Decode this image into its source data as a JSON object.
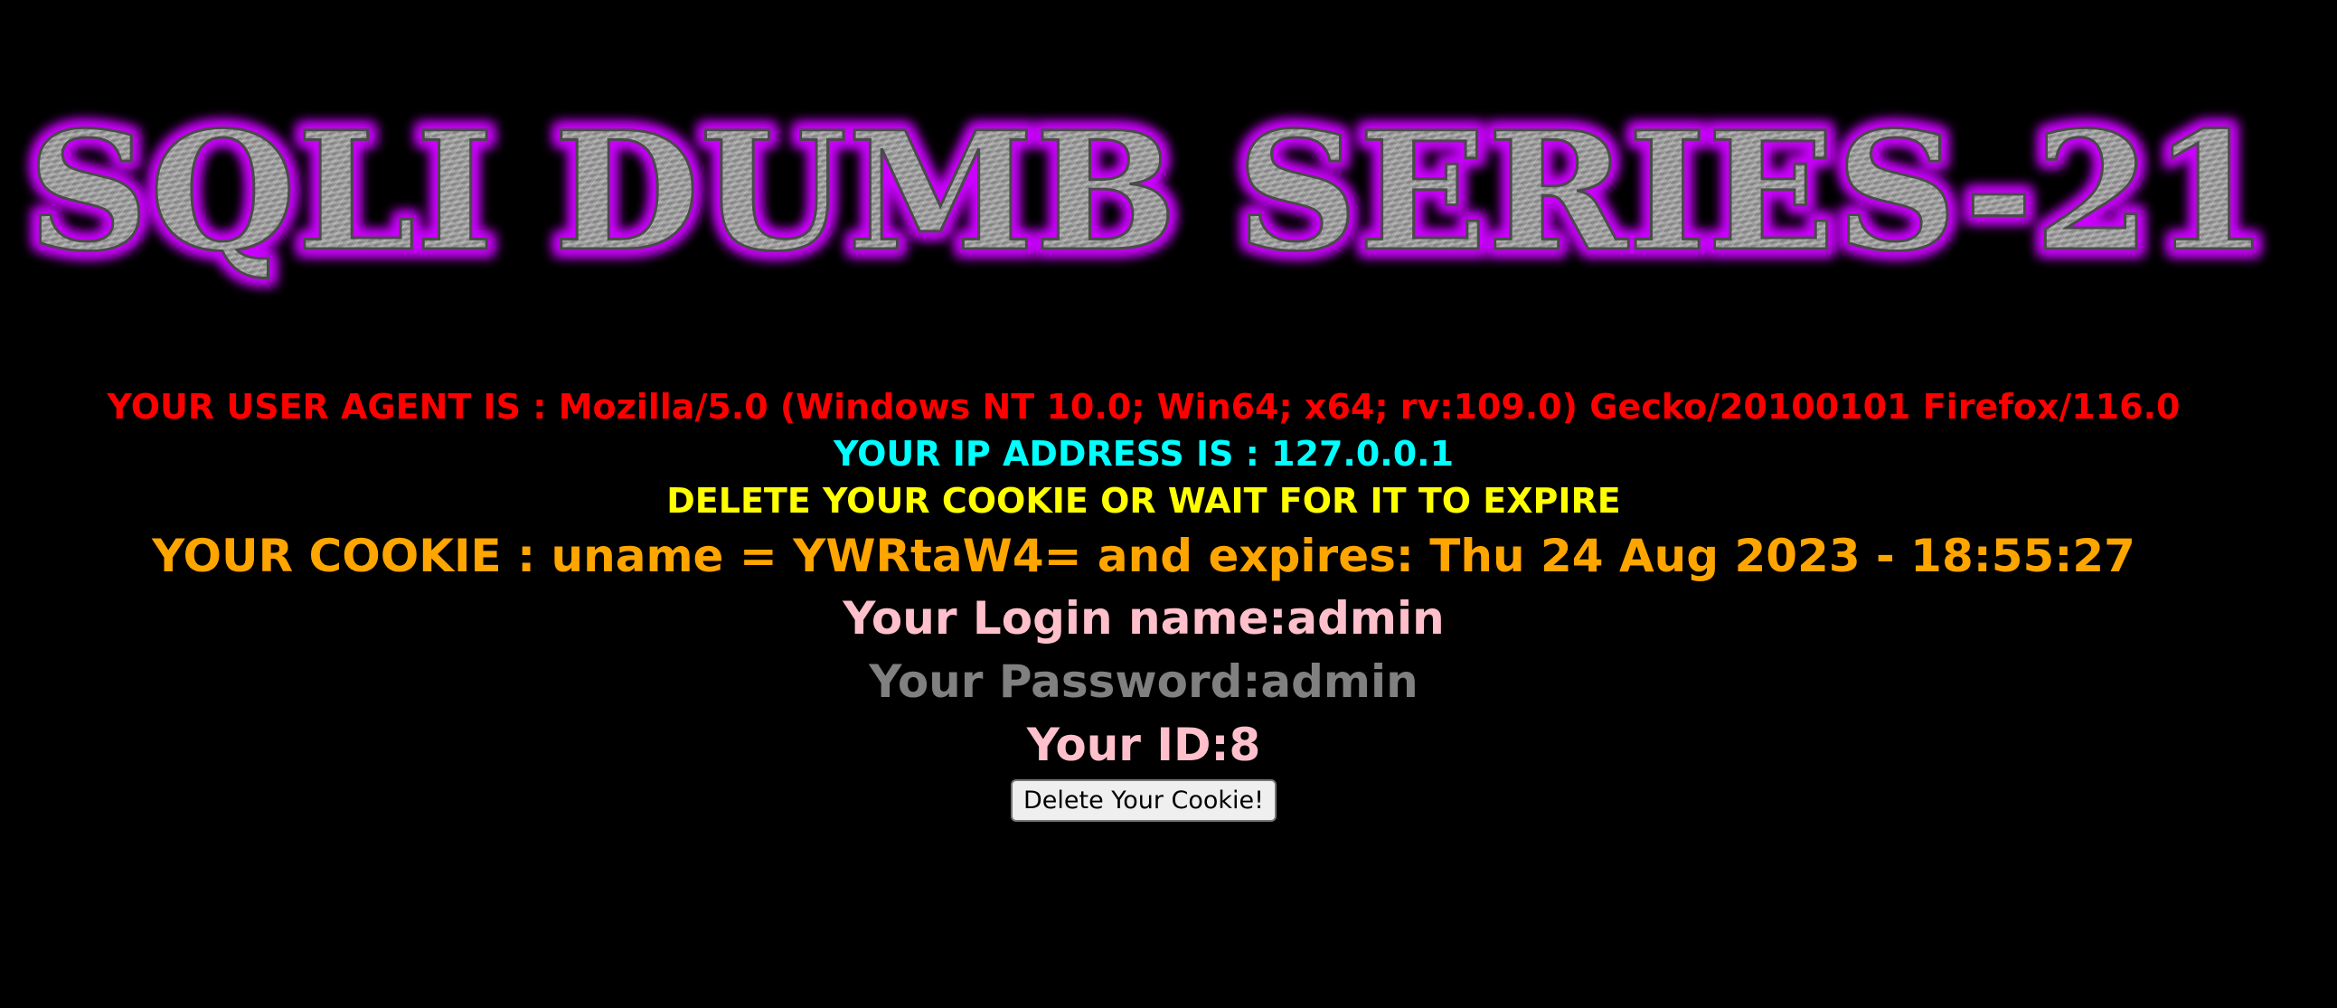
{
  "banner": {
    "text": "SQLI DUMB SERIES-21",
    "glow_color": "#cc00ff",
    "fill_color": "#9a9a9a"
  },
  "info": {
    "user_agent": "YOUR USER AGENT IS : Mozilla/5.0 (Windows NT 10.0; Win64; x64; rv:109.0) Gecko/20100101 Firefox/116.0",
    "ip_address": "YOUR IP ADDRESS IS : 127.0.0.1",
    "delete_notice": "DELETE YOUR COOKIE OR WAIT FOR IT TO EXPIRE",
    "cookie": "YOUR COOKIE : uname = YWRtaW4= and expires: Thu 24 Aug 2023 - 18:55:27",
    "login_name": "Your Login name:admin",
    "password": "Your Password:admin",
    "id": "Your ID:8"
  },
  "button": {
    "label": "Delete Your Cookie!"
  },
  "colors": {
    "background": "#000000",
    "user_agent": "#ff0000",
    "ip_address": "#00ffff",
    "delete_notice": "#ffff00",
    "cookie": "#ffa500",
    "login_name": "#ffc0cb",
    "password": "#808080",
    "id": "#ffc0cb"
  }
}
